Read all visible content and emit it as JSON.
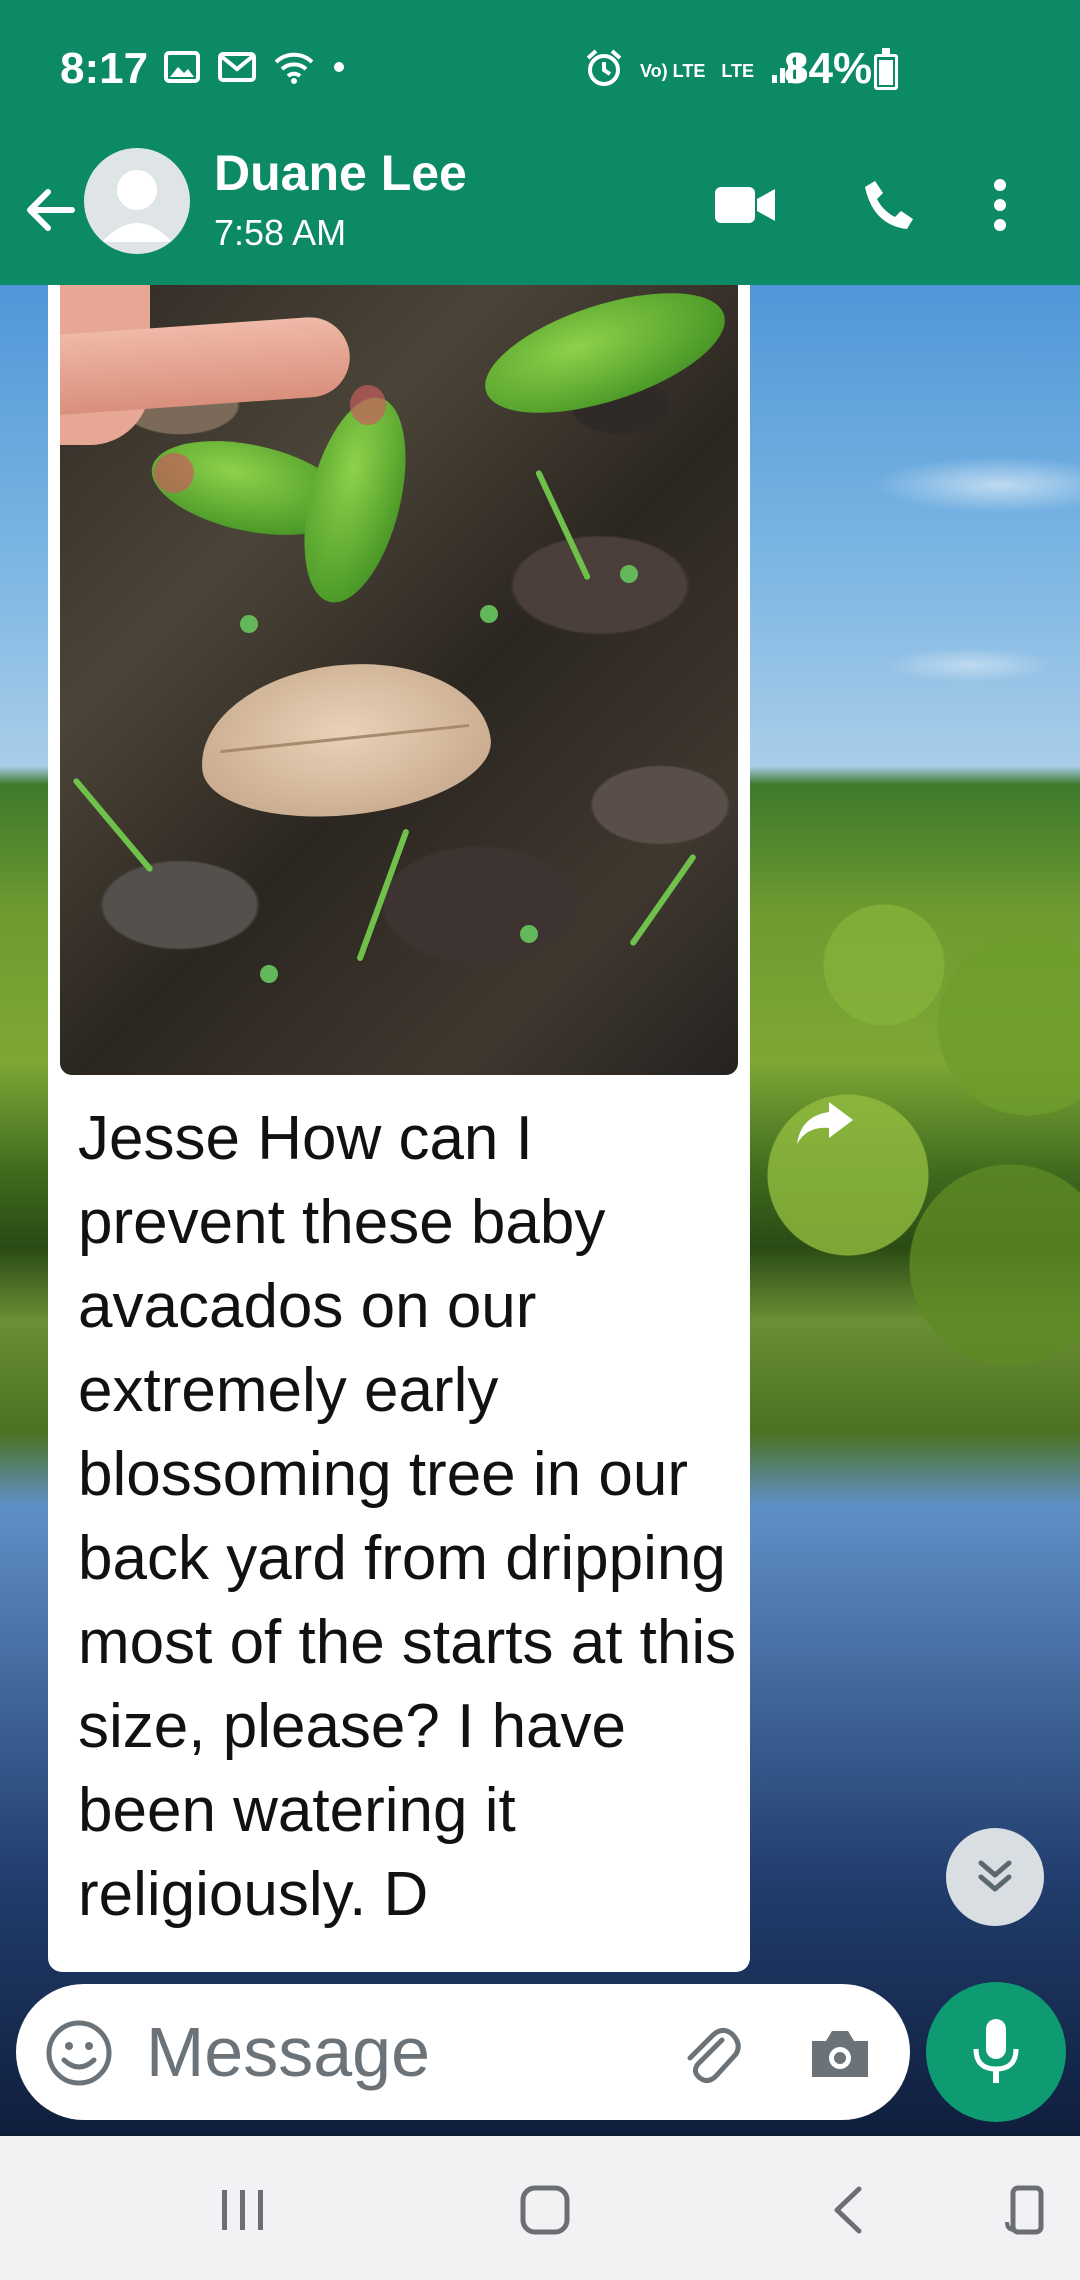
{
  "status_bar": {
    "time": "8:17",
    "battery_percent": "84%",
    "battery_level": 0.84,
    "network_label_top": "Vo) LTE",
    "network_label_bottom": "LTE",
    "icons": [
      "image-icon",
      "mail-icon",
      "wifi-icon",
      "dot-icon",
      "alarm-icon",
      "volte-icon",
      "lte-icon",
      "signal-icon",
      "battery-icon"
    ]
  },
  "header": {
    "contact_name": "Duane Lee",
    "contact_status": "7:58 AM",
    "icons": [
      "back-arrow-icon",
      "avatar-icon",
      "video-call-icon",
      "phone-call-icon",
      "more-options-icon"
    ]
  },
  "message": {
    "text": "Jesse How can I prevent these baby avacados on our extremely early blossoming tree in our back yard from dripping most of the starts at this size, please? I have been watering it religiously. D",
    "forward_icon": "forward-icon"
  },
  "scroll_down": {
    "icon": "double-chevron-down-icon"
  },
  "composer": {
    "placeholder": "Message",
    "icons": [
      "emoji-icon",
      "paperclip-icon",
      "camera-icon",
      "mic-icon"
    ]
  },
  "nav_bar": {
    "icons": [
      "recent-apps-icon",
      "home-icon",
      "back-icon",
      "rotate-icon"
    ]
  },
  "colors": {
    "header": "#0b8a65",
    "mic_button": "#0e9b72",
    "bubble": "#ffffff",
    "nav_bar": "#f2f2f4"
  }
}
